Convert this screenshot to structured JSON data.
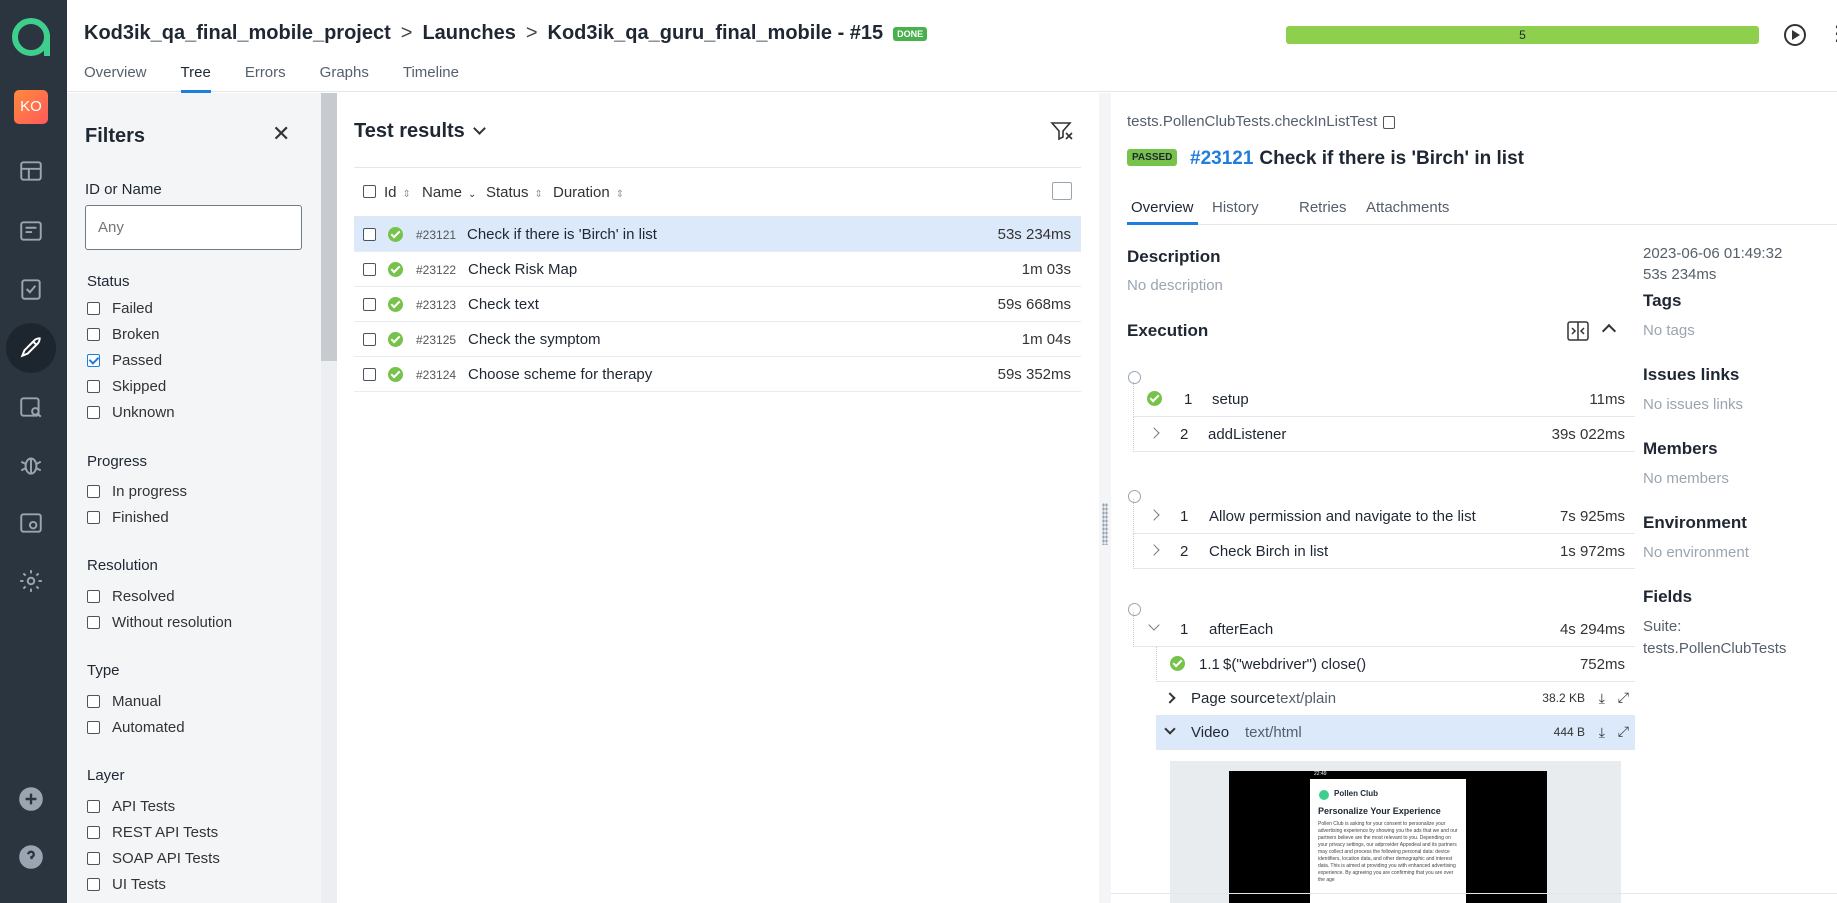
{
  "header": {
    "breadcrumbs": [
      "Kod3ik_qa_final_mobile_project",
      "Launches",
      "Kod3ik_qa_guru_final_mobile - #15"
    ],
    "launch_status_badge": "DONE",
    "progress_value": "5",
    "progress_fraction": 1.0,
    "tabs": [
      "Overview",
      "Tree",
      "Errors",
      "Graphs",
      "Timeline"
    ],
    "active_tab": "Tree"
  },
  "nav": {
    "avatar": "KO",
    "icons": [
      "allure-logo-icon",
      "dashboard-icon",
      "test-cases-icon",
      "test-plans-icon",
      "launches-icon",
      "analytics-icon",
      "defects-icon",
      "jobs-icon",
      "settings-icon",
      "add-icon",
      "help-icon"
    ]
  },
  "filters": {
    "title": "Filters",
    "id_label": "ID or Name",
    "id_placeholder": "Any",
    "groups": {
      "status": {
        "label": "Status",
        "options": [
          "Failed",
          "Broken",
          "Passed",
          "Skipped",
          "Unknown"
        ],
        "checked": [
          "Passed"
        ]
      },
      "progress": {
        "label": "Progress",
        "options": [
          "In progress",
          "Finished"
        ]
      },
      "resolution": {
        "label": "Resolution",
        "options": [
          "Resolved",
          "Without resolution"
        ]
      },
      "type": {
        "label": "Type",
        "options": [
          "Manual",
          "Automated"
        ]
      },
      "layer": {
        "label": "Layer",
        "options": [
          "API Tests",
          "REST API Tests",
          "SOAP API Tests",
          "UI Tests"
        ]
      }
    }
  },
  "results": {
    "title": "Test results",
    "columns": [
      "Id",
      "Name",
      "Status",
      "Duration"
    ],
    "rows": [
      {
        "id": "#23121",
        "name": "Check if there is 'Birch' in list",
        "duration": "53s 234ms"
      },
      {
        "id": "#23122",
        "name": "Check Risk Map",
        "duration": "1m 03s"
      },
      {
        "id": "#23123",
        "name": "Check text",
        "duration": "59s 668ms"
      },
      {
        "id": "#23125",
        "name": "Check the symptom",
        "duration": "1m 04s"
      },
      {
        "id": "#23124",
        "name": "Choose scheme for therapy",
        "duration": "59s 352ms"
      }
    ]
  },
  "detail": {
    "path": "tests.PollenClubTests.checkInListTest",
    "status_badge": "PASSED",
    "id": "#23121",
    "title": "Check if there is 'Birch' in list",
    "tabs": [
      "Overview",
      "History",
      "Retries",
      "Attachments"
    ],
    "description_label": "Description",
    "description_value": "No description",
    "execution_label": "Execution",
    "setup_steps": [
      {
        "num": "1",
        "name": "setup",
        "duration": "11ms"
      },
      {
        "num": "2",
        "name": "addListener",
        "duration": "39s 022ms"
      }
    ],
    "test_steps": [
      {
        "num": "1",
        "name": "Allow permission and navigate to the list",
        "duration": "7s 925ms"
      },
      {
        "num": "2",
        "name": "Check Birch in list",
        "duration": "1s 972ms"
      }
    ],
    "teardown_steps": [
      {
        "num": "1",
        "name": "afterEach",
        "duration": "4s 294ms"
      },
      {
        "num": "1.1",
        "name": "$(\"webdriver\") close()",
        "duration": "752ms"
      }
    ],
    "attachments": [
      {
        "name": "Page source",
        "type": "text/plain",
        "size": "38.2 KB"
      },
      {
        "name": "Video",
        "type": "text/html",
        "size": "444 B"
      }
    ],
    "video_preview": {
      "status_time": "22:49",
      "app_name": "Pollen Club",
      "heading": "Personalize Your Experience",
      "body": "Pollen Club is asking for your consent to personalize your advertising experience by showing you the ads that we and our partners believe are the most relevant to you. Depending on your privacy settings, our adprovider Appodeal and its partners may collect and process the following personal data: device identifiers, location data, and other demographic and interest data. This is aimed at providing you with enhanced advertising experience. By agreeing you are confirming that you are over the age"
    }
  },
  "side": {
    "date": "2023-06-06 01:49:32",
    "duration": "53s 234ms",
    "tags_label": "Tags",
    "tags_value": "No tags",
    "issues_label": "Issues links",
    "issues_value": "No issues links",
    "members_label": "Members",
    "members_value": "No members",
    "environment_label": "Environment",
    "environment_value": "No environment",
    "fields_label": "Fields",
    "fields_key": "Suite:",
    "fields_value": "tests.PollenClubTests"
  }
}
